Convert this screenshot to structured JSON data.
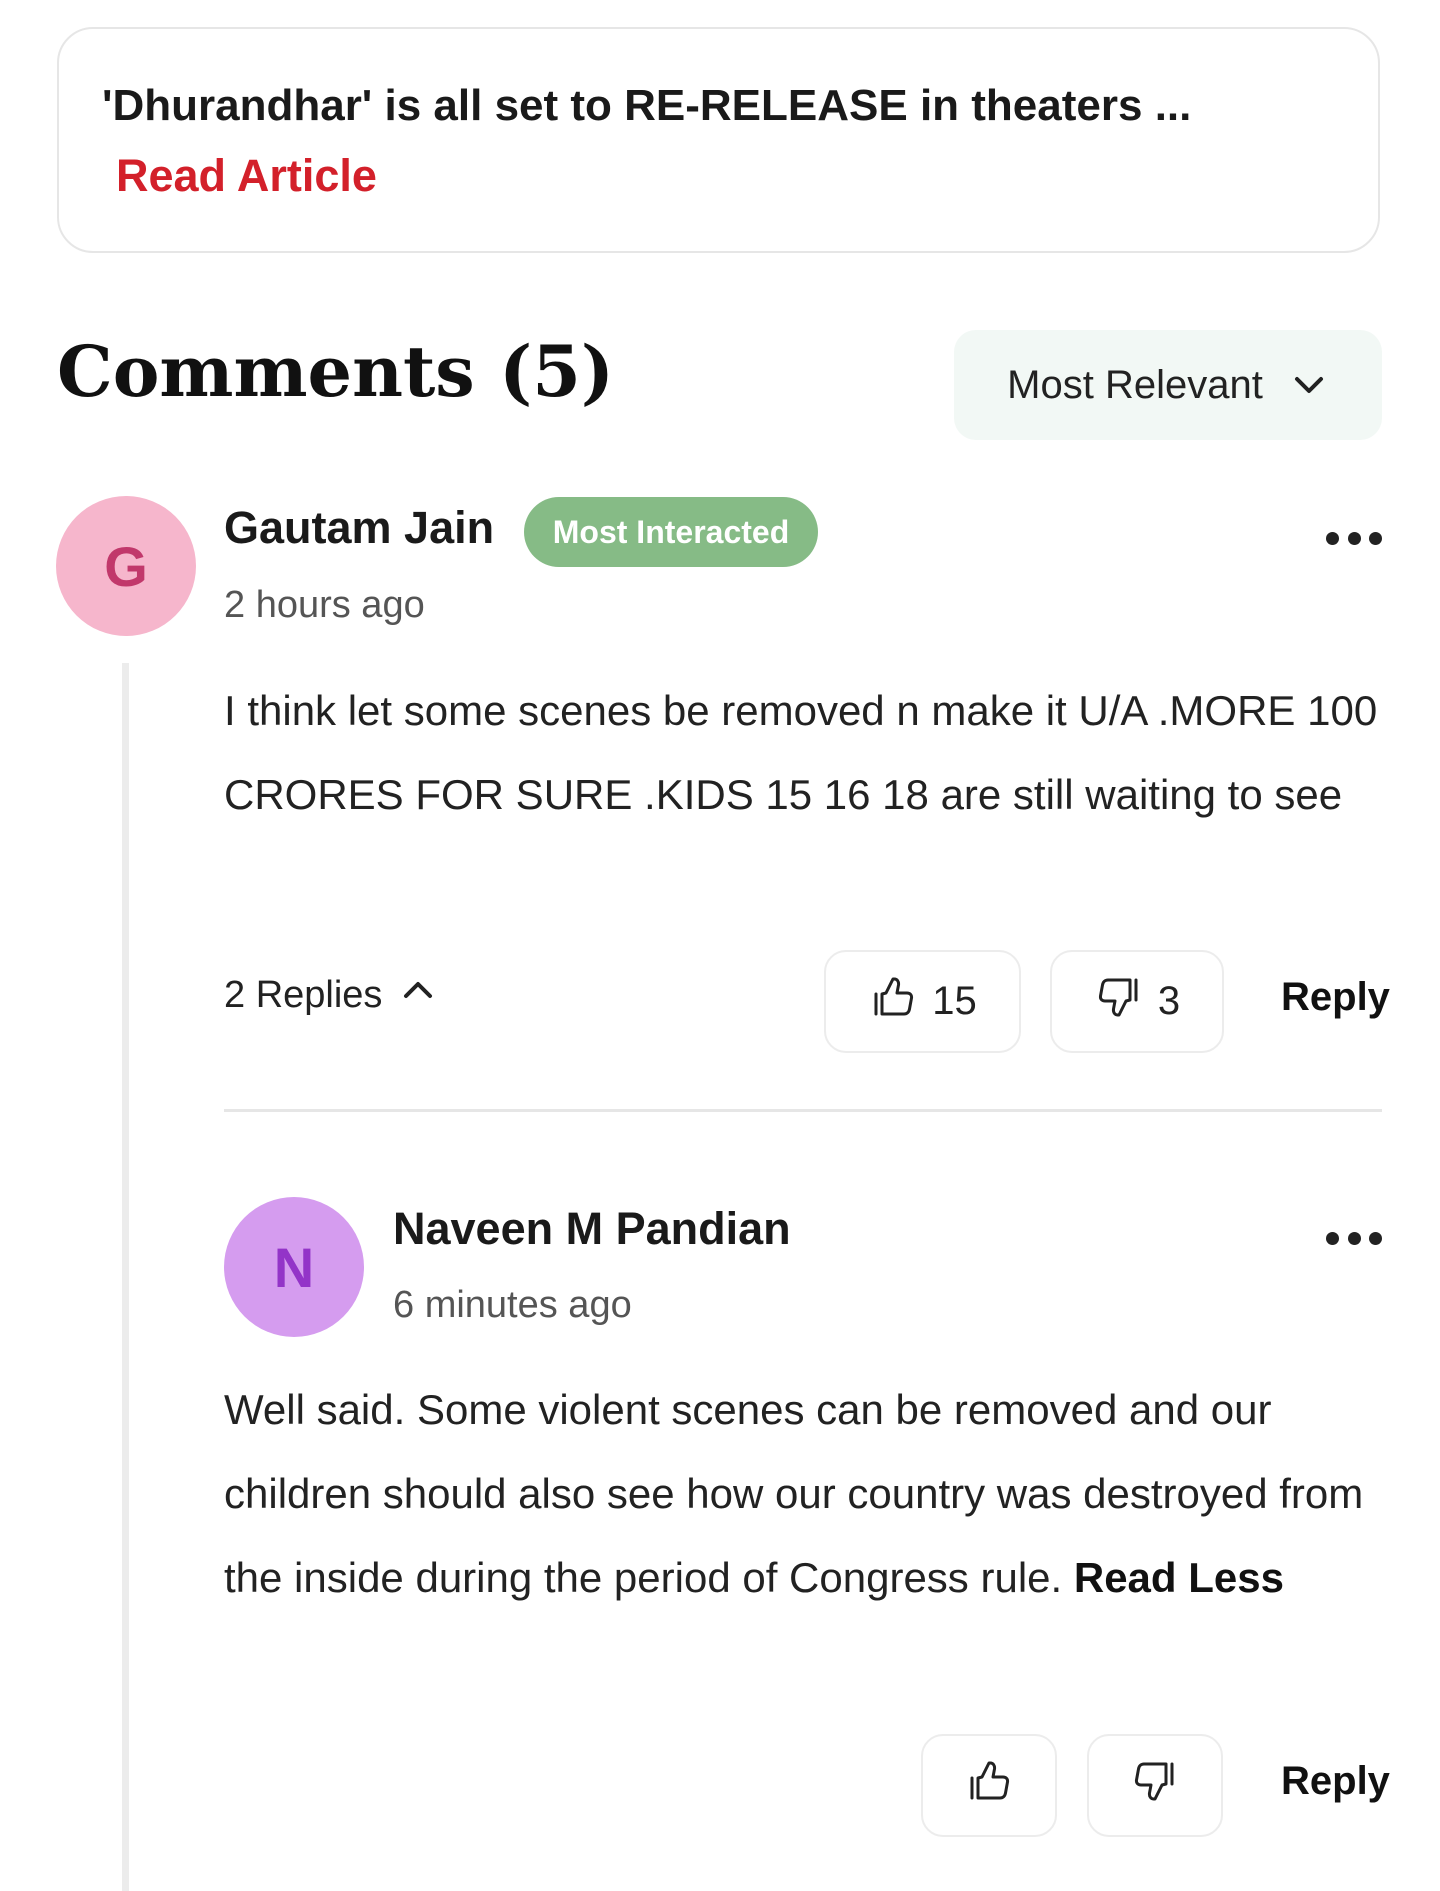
{
  "article": {
    "title": "'Dhurandhar' is all set to RE-RELEASE in theaters ...",
    "read_label": "Read Article"
  },
  "comments_section": {
    "heading": "Comments (5)",
    "sort": {
      "selected": "Most Relevant"
    }
  },
  "comments": [
    {
      "avatar_initial": "G",
      "author": "Gautam Jain",
      "badge": "Most Interacted",
      "time": "2 hours ago",
      "body": "I think let some scenes be removed n make it U/A .MORE 100 CRORES FOR SURE .KIDS 15 16 18 are still waiting to see",
      "replies_label": "2 Replies",
      "likes": "15",
      "dislikes": "3",
      "reply_label": "Reply"
    }
  ],
  "replies": [
    {
      "avatar_initial": "N",
      "author": "Naveen M Pandian",
      "time": "6 minutes ago",
      "body": "Well said. Some violent scenes can be removed and our children should also see how our country was destroyed from the inside during the period of Congress rule.",
      "read_less_label": "Read Less",
      "reply_label": "Reply"
    }
  ],
  "icons": {
    "sort": "chevron-down-icon",
    "replies": "chevron-up-icon",
    "like": "thumbs-up-icon",
    "dislike": "thumbs-down-icon",
    "more": "more-options-icon"
  },
  "colors": {
    "accent_red": "#d3202a",
    "badge_green": "#86bb86",
    "avatar_g_bg": "#f6b6cc",
    "avatar_n_bg": "#d59cef"
  }
}
